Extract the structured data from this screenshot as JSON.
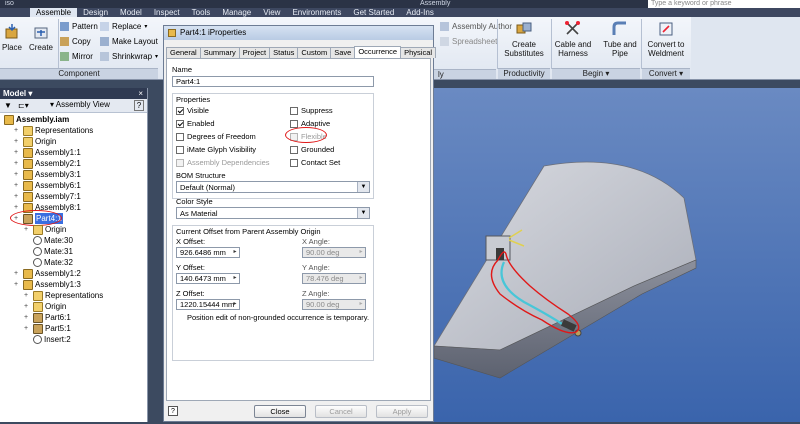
{
  "ribbon": {
    "top_left_label": "iso",
    "search_placeholder": "Type a keyword or phrase",
    "title_fragment": "Assembly",
    "tabs": [
      "Assemble",
      "Design",
      "Model",
      "Inspect",
      "Tools",
      "Manage",
      "View",
      "Environments",
      "Get Started",
      "Add-Ins"
    ],
    "active_tab": "Assemble",
    "place_label": "Place",
    "create_label": "Create",
    "pattern_label": "Pattern",
    "copy_label": "Copy",
    "mirror_label": "Mirror",
    "replace_label": "Replace",
    "make_layout_label": "Make Layout",
    "shrinkwrap_label": "Shrinkwrap",
    "component_panel": "Component",
    "assembly_author_label": "Assembly Author",
    "spreadsheet_label": "Spreadsheet",
    "ly_panel": "ly",
    "create_substitutes_label": "Create Substitutes",
    "productivity_panel": "Productivity",
    "cable_harness_label": "Cable and Harness",
    "tube_pipe_label": "Tube and Pipe",
    "begin_panel": "Begin",
    "convert_weldment_label": "Convert to Weldment",
    "convert_panel": "Convert"
  },
  "browser": {
    "title": "Model",
    "view_label": "Assembly View",
    "help_label": "?",
    "close_label": "×",
    "items": [
      {
        "label": "Assembly.iam",
        "type": "asm",
        "indent": 0,
        "bold": true
      },
      {
        "label": "Representations",
        "type": "folder",
        "indent": 1
      },
      {
        "label": "Origin",
        "type": "folder",
        "indent": 1
      },
      {
        "label": "Assembly1:1",
        "type": "asm",
        "indent": 1
      },
      {
        "label": "Assembly2:1",
        "type": "asm",
        "indent": 1
      },
      {
        "label": "Assembly3:1",
        "type": "asm",
        "indent": 1
      },
      {
        "label": "Assembly6:1",
        "type": "asm",
        "indent": 1
      },
      {
        "label": "Assembly7:1",
        "type": "asm",
        "indent": 1
      },
      {
        "label": "Assembly8:1",
        "type": "asm",
        "indent": 1
      },
      {
        "label": "Part4:1",
        "type": "part",
        "indent": 1,
        "selected": true
      },
      {
        "label": "Origin",
        "type": "folder",
        "indent": 2
      },
      {
        "label": "Mate:30",
        "type": "mate",
        "indent": 2
      },
      {
        "label": "Mate:31",
        "type": "mate",
        "indent": 2
      },
      {
        "label": "Mate:32",
        "type": "mate",
        "indent": 2
      },
      {
        "label": "Assembly1:2",
        "type": "asm",
        "indent": 1
      },
      {
        "label": "Assembly1:3",
        "type": "asm",
        "indent": 1
      },
      {
        "label": "Representations",
        "type": "folder",
        "indent": 2
      },
      {
        "label": "Origin",
        "type": "folder",
        "indent": 2
      },
      {
        "label": "Part6:1",
        "type": "part",
        "indent": 2
      },
      {
        "label": "Part5:1",
        "type": "part",
        "indent": 2
      },
      {
        "label": "Insert:2",
        "type": "mate",
        "indent": 2
      }
    ]
  },
  "dialog": {
    "title": "Part4:1 iProperties",
    "tabs": [
      "General",
      "Summary",
      "Project",
      "Status",
      "Custom",
      "Save",
      "Occurrence",
      "Physical"
    ],
    "active_tab": "Occurrence",
    "name_label": "Name",
    "name_value": "Part4:1",
    "properties_label": "Properties",
    "checkboxes": {
      "visible": {
        "label": "Visible",
        "checked": true,
        "enabled": true
      },
      "enabled": {
        "label": "Enabled",
        "checked": true,
        "enabled": true
      },
      "dof": {
        "label": "Degrees of Freedom",
        "checked": false,
        "enabled": true
      },
      "imate": {
        "label": "iMate Glyph Visibility",
        "checked": false,
        "enabled": true
      },
      "asm_dep": {
        "label": "Assembly Dependencies",
        "checked": false,
        "enabled": false
      },
      "suppress": {
        "label": "Suppress",
        "checked": false,
        "enabled": true
      },
      "adaptive": {
        "label": "Adaptive",
        "checked": false,
        "enabled": true
      },
      "flexible": {
        "label": "Flexible",
        "checked": false,
        "enabled": false
      },
      "grounded": {
        "label": "Grounded",
        "checked": false,
        "enabled": true
      },
      "contact": {
        "label": "Contact Set",
        "checked": false,
        "enabled": true
      }
    },
    "bom_label": "BOM Structure",
    "bom_value": "Default (Normal)",
    "color_label": "Color Style",
    "color_value": "As Material",
    "offset_label": "Current Offset from Parent Assembly Origin",
    "x_offset_label": "X Offset:",
    "x_offset_value": "926.6486 mm",
    "y_offset_label": "Y Offset:",
    "y_offset_value": "140.6473 mm",
    "z_offset_label": "Z Offset:",
    "z_offset_value": "1220.15444 mm",
    "x_angle_label": "X Angle:",
    "x_angle_value": "90.00 deg",
    "y_angle_label": "Y Angle:",
    "y_angle_value": "78.476 deg",
    "z_angle_label": "Z Angle:",
    "z_angle_value": "90.00 deg",
    "note": "Position edit of non-grounded occurrence is temporary.",
    "help_label": "?",
    "close_label": "Close",
    "cancel_label": "Cancel",
    "apply_label": "Apply"
  },
  "colors": {
    "ribbon_tab_bar": "#3d4760",
    "viewport_top": "#6a8ac2",
    "viewport_bottom": "#3a64ac",
    "annotation_red": "#e01818",
    "selection_blue": "#3a6ee0"
  }
}
